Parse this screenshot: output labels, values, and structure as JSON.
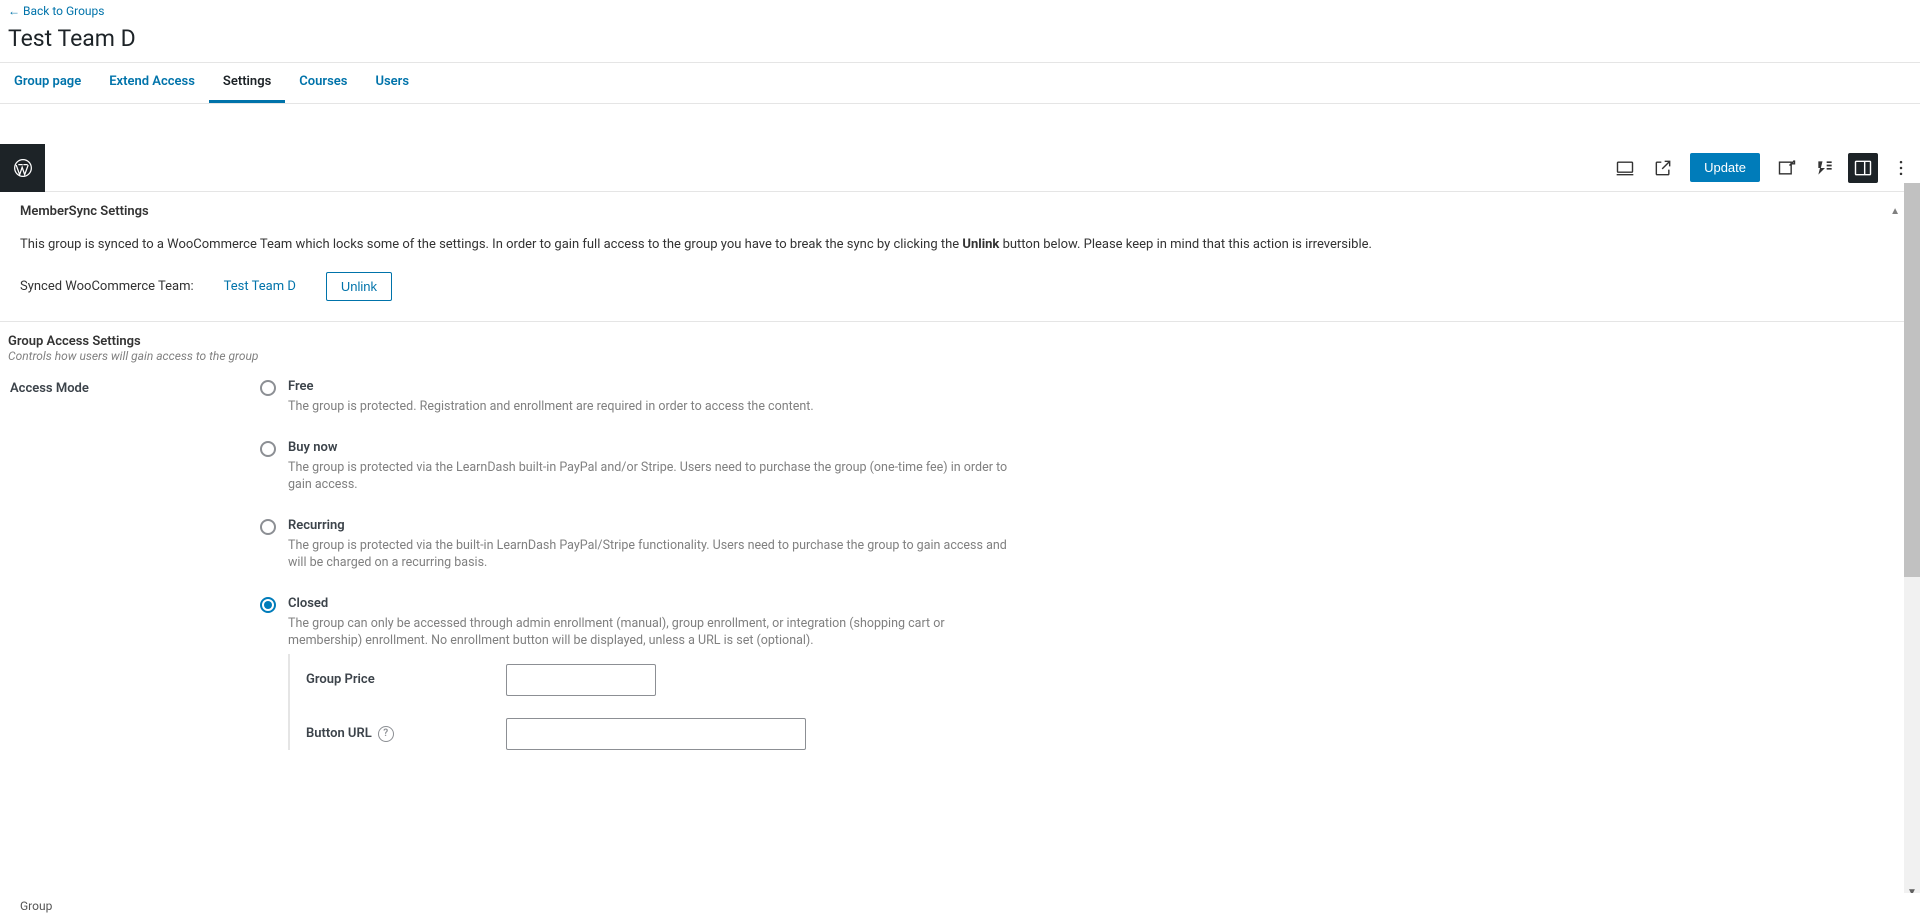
{
  "back_link": "← Back to Groups",
  "page_title": "Test Team D",
  "tabs": {
    "group_page": "Group page",
    "extend_access": "Extend Access",
    "settings": "Settings",
    "courses": "Courses",
    "users": "Users"
  },
  "editor": {
    "update": "Update"
  },
  "membersync": {
    "title": "MemberSync Settings",
    "desc_pre": "This group is synced to a WooCommerce Team which locks some of the settings. In order to gain full access to the group you have to break the sync by clicking the ",
    "desc_strong": "Unlink",
    "desc_post": " button below. Please keep in mind that this action is irreversible.",
    "synced_label": "Synced WooCommerce Team:",
    "synced_team": "Test Team D",
    "unlink_btn": "Unlink"
  },
  "access": {
    "title": "Group Access Settings",
    "subtitle": "Controls how users will gain access to the group",
    "mode_label": "Access Mode",
    "options": {
      "free": {
        "title": "Free",
        "desc": "The group is protected. Registration and enrollment are required in order to access the content."
      },
      "buy": {
        "title": "Buy now",
        "desc": "The group is protected via the LearnDash built-in PayPal and/or Stripe. Users need to purchase the group (one-time fee) in order to gain access."
      },
      "recurring": {
        "title": "Recurring",
        "desc": "The group is protected via the built-in LearnDash PayPal/Stripe functionality. Users need to purchase the group to gain access and will be charged on a recurring basis."
      },
      "closed": {
        "title": "Closed",
        "desc": "The group can only be accessed through admin enrollment (manual), group enrollment, or integration (shopping cart or membership) enrollment. No enrollment button will be displayed, unless a URL is set (optional)."
      }
    },
    "fields": {
      "price_label": "Group Price",
      "url_label": "Button URL"
    }
  },
  "footer": "Group"
}
